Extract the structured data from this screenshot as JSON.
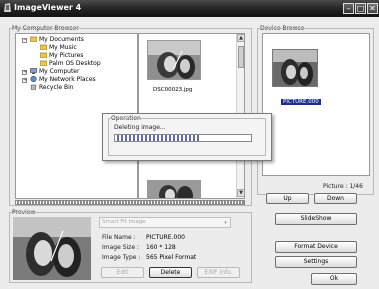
{
  "window": {
    "title": "ImageViewer 4"
  },
  "left_browser": {
    "label": "My Computer Browser",
    "tree": [
      {
        "label": "My Documents",
        "icon": "folder-open-icon",
        "expander": "⊟"
      },
      {
        "label": "My Music",
        "icon": "folder-icon"
      },
      {
        "label": "My Pictures",
        "icon": "folder-icon"
      },
      {
        "label": "Palm OS Desktop",
        "icon": "folder-icon"
      },
      {
        "label": "My Computer",
        "icon": "computer-icon",
        "expander": "⊞"
      },
      {
        "label": "My Network Places",
        "icon": "network-icon",
        "expander": "⊞"
      },
      {
        "label": "Recycle Bin",
        "icon": "recycle-bin-icon"
      }
    ],
    "thumbnail_name": "DSC00023.jpg"
  },
  "device_browser": {
    "label": "Device Browse",
    "thumbnail_name": "PICTURE.000",
    "counter": "Picture : 1/46",
    "up_label": "Up",
    "down_label": "Down"
  },
  "operation_dialog": {
    "group_label": "Operation",
    "status": "Deleting image...",
    "progress": 0.62
  },
  "preview": {
    "label": "Preview",
    "fit_select": "Smart Fit Image",
    "file_name_label": "File Name :",
    "file_name": "PICTURE.000",
    "image_size_label": "Image Size :",
    "image_size": "160 * 128",
    "image_type_label": "Image Type :",
    "image_type": "565 Pixel Format",
    "edit_label": "Edit",
    "delete_label": "Delete",
    "exif_label": "EXIF Info."
  },
  "actions": {
    "slideshow_label": "SlideShow",
    "format_label": "Format Device",
    "settings_label": "Settings",
    "ok_label": "Ok"
  }
}
